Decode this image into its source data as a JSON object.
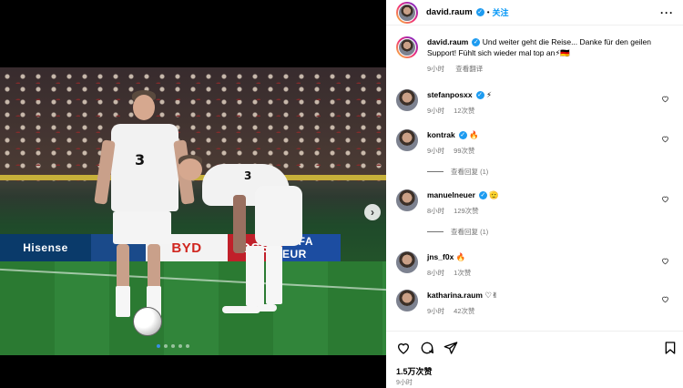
{
  "photo": {
    "ads": [
      "Hisense",
      "BYD",
      "OSS",
      "UEFA EUR"
    ],
    "player_numbers": [
      "3",
      "3"
    ],
    "carousel_dots": 5,
    "active_dot": 0
  },
  "post": {
    "author": "david.raum",
    "separator": "•",
    "follow_label": "关注",
    "more_label": "···",
    "caption": {
      "username": "david.raum",
      "text": "Und weiter geht die Reise... Danke für den geilen Support! Fühlt sich wieder mal top an⚡🇩🇪",
      "time": "9小时",
      "translate_label": "查看翻译"
    },
    "comments": [
      {
        "username": "stefanposxx",
        "verified": true,
        "text": "⚡",
        "time": "9小时",
        "likes": "12次赞"
      },
      {
        "username": "kontrak",
        "verified": true,
        "text": "🔥",
        "time": "9小时",
        "likes": "99次赞",
        "replies": "查看回复 (1)"
      },
      {
        "username": "manuelneuer",
        "verified": true,
        "text": "🫡",
        "time": "8小时",
        "likes": "129次赞",
        "replies": "查看回复 (1)"
      },
      {
        "username": "jns_f0x",
        "verified": false,
        "text": "🔥",
        "time": "8小时",
        "likes": "1次赞"
      },
      {
        "username": "katharina.raum",
        "verified": false,
        "text": "♡✌",
        "time": "9小时",
        "likes": "42次赞"
      }
    ],
    "like_count": "1.5万次赞",
    "posted_ago": "9小时"
  },
  "colors": {
    "link_blue": "#0095f6",
    "verified_blue": "#1d9bf0",
    "secondary_text": "#737373"
  },
  "icons": [
    "heart-icon",
    "comment-icon",
    "share-icon",
    "bookmark-icon",
    "verified-badge-icon",
    "chevron-right-icon"
  ]
}
